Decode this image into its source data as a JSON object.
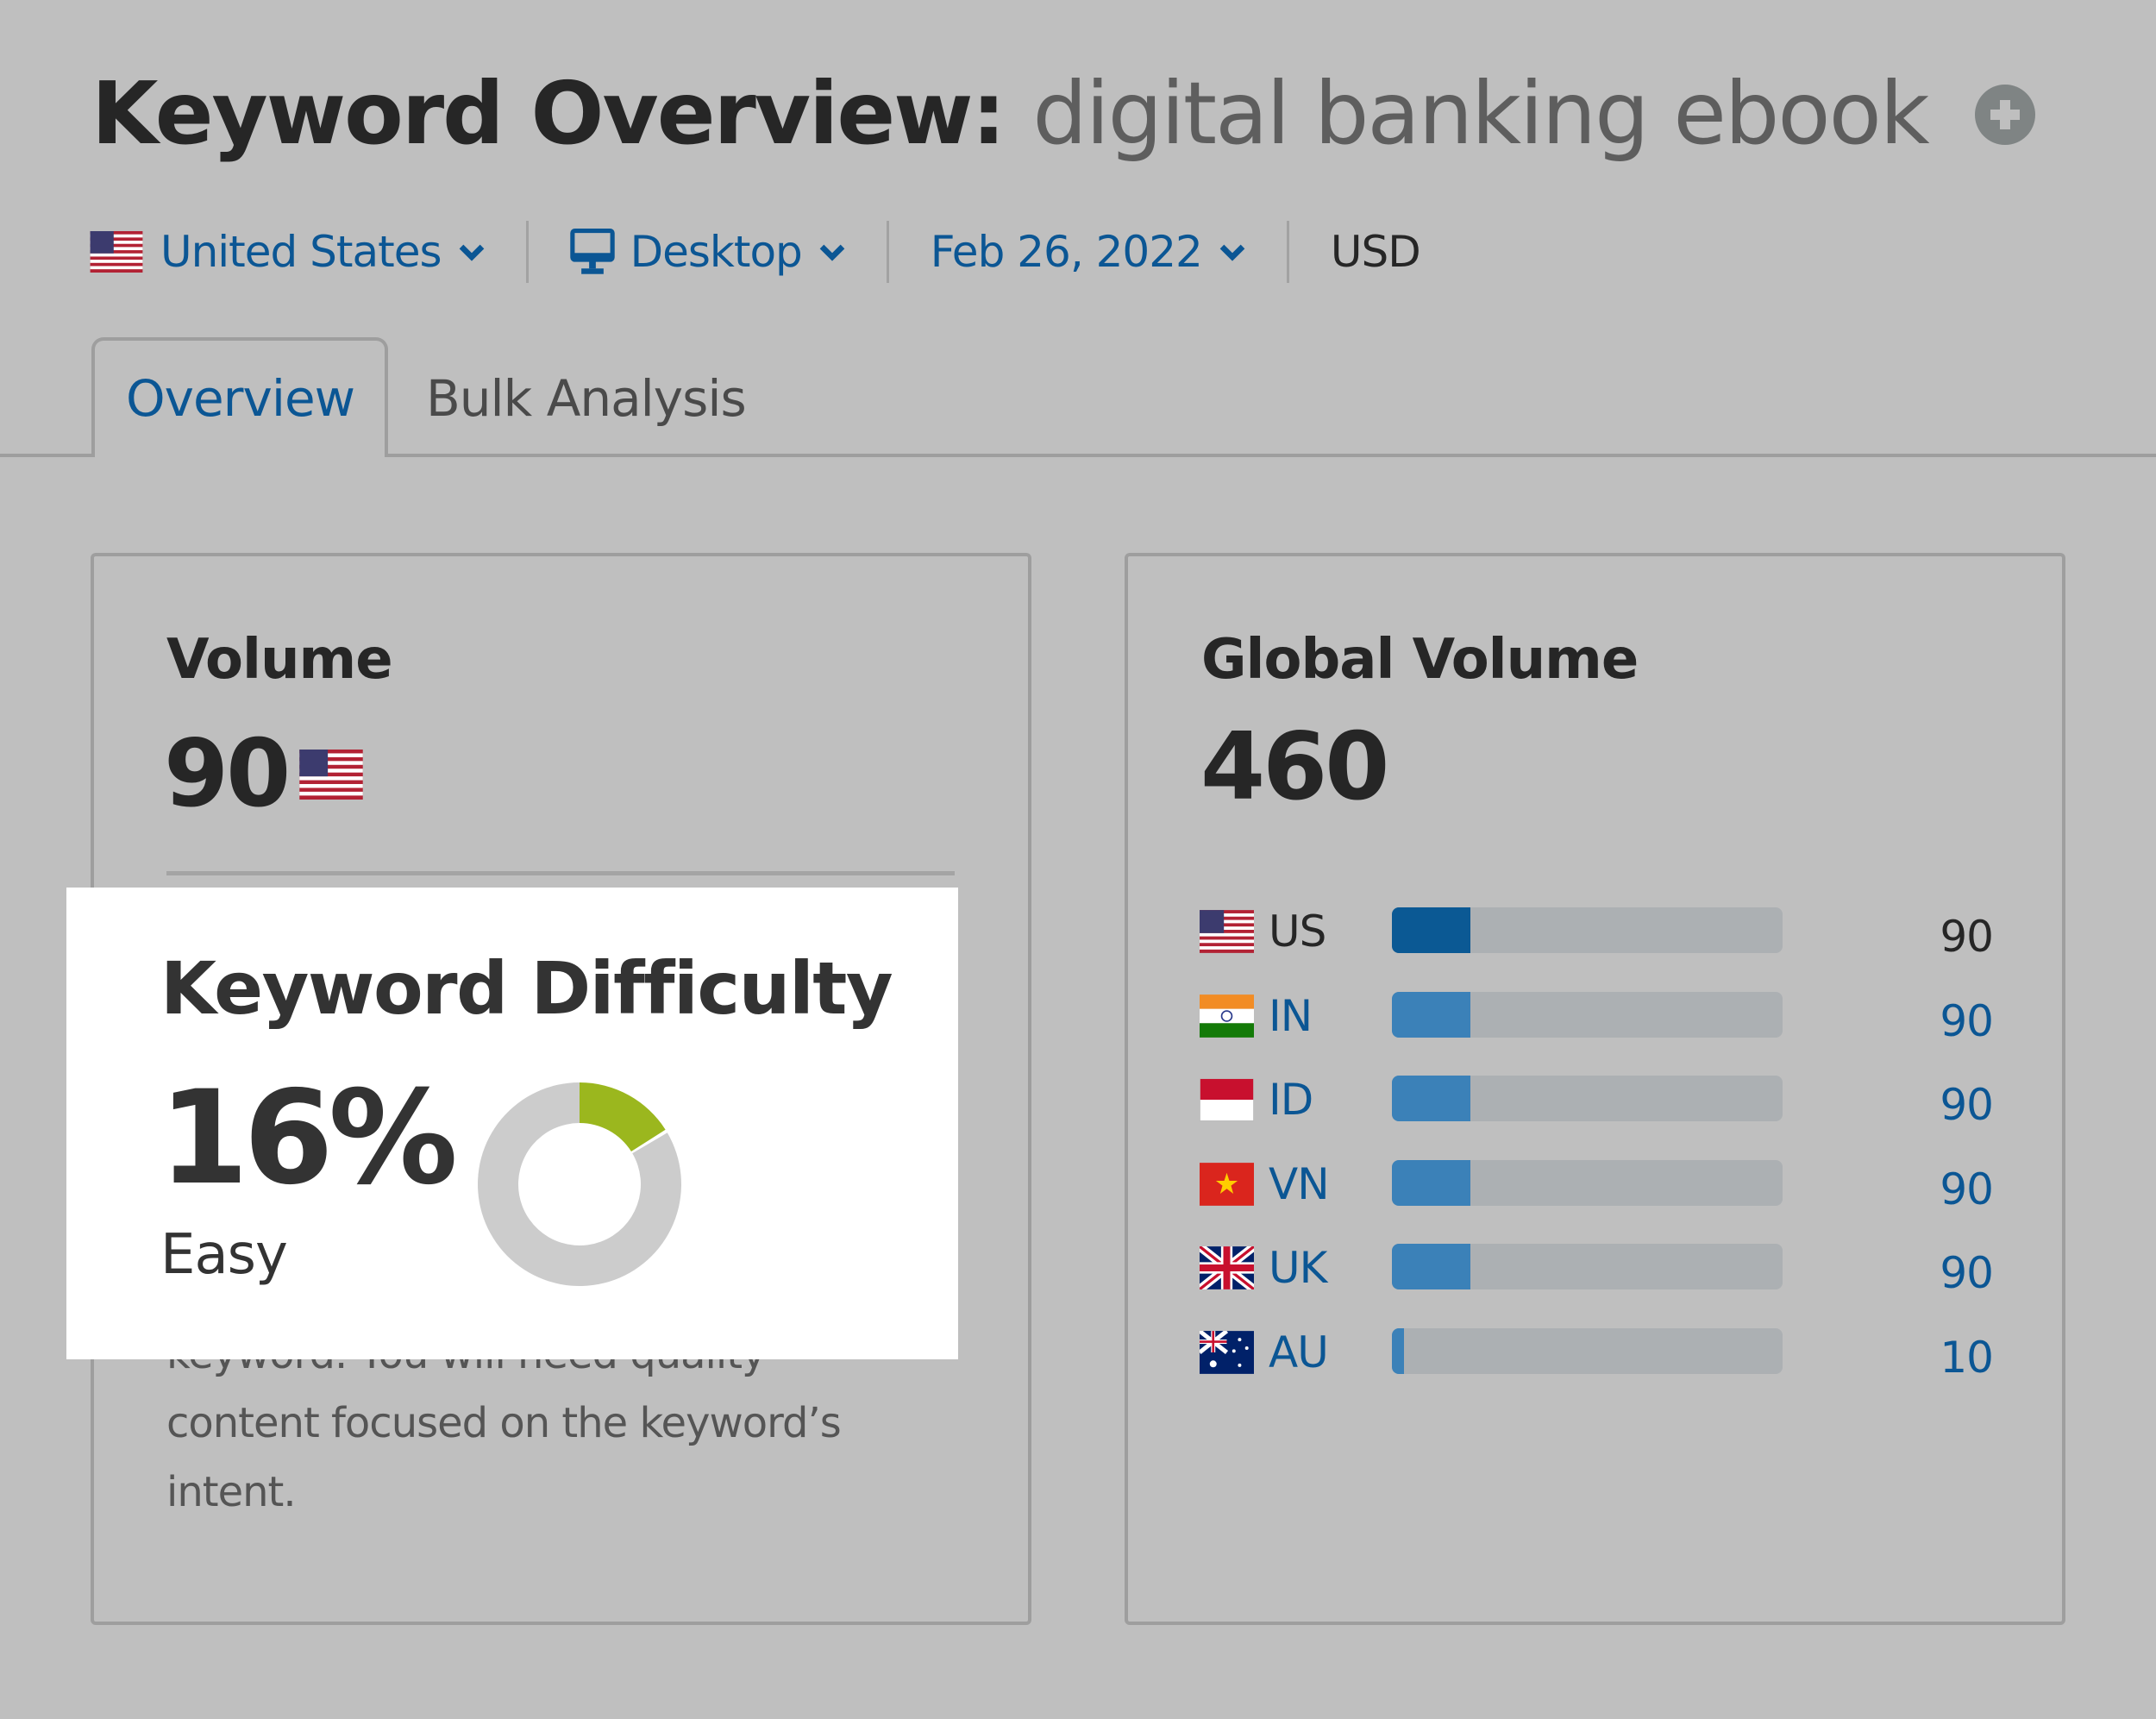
{
  "header": {
    "title_prefix": "Keyword Overview:",
    "keyword": "digital banking ebook",
    "add_icon": "plus-circle-icon"
  },
  "filters": {
    "country": {
      "label": "United States",
      "flag": "us-flag-icon"
    },
    "device": {
      "label": "Desktop",
      "icon": "desktop-icon"
    },
    "date": {
      "label": "Feb 26, 2022"
    },
    "currency": "USD"
  },
  "tabs": [
    {
      "label": "Overview",
      "active": true
    },
    {
      "label": "Bulk Analysis",
      "active": false
    }
  ],
  "volume_card": {
    "heading": "Volume",
    "value": "90",
    "flag": "us-flag-icon"
  },
  "keyword_difficulty": {
    "heading": "Keyword Difficulty",
    "value": "16%",
    "percent": 16,
    "level": "Easy",
    "description_lines": [
      "keyword. You will need quality",
      "content focused on the keyword’s",
      "intent."
    ],
    "colors": {
      "fill": "#9bb71e",
      "track": "#cccccc"
    }
  },
  "global_volume": {
    "heading": "Global Volume",
    "value": "460",
    "max": 450,
    "rows": [
      {
        "code": "US",
        "value": "90",
        "num": 90,
        "flag": "us"
      },
      {
        "code": "IN",
        "value": "90",
        "num": 90,
        "flag": "in"
      },
      {
        "code": "ID",
        "value": "90",
        "num": 90,
        "flag": "id"
      },
      {
        "code": "VN",
        "value": "90",
        "num": 90,
        "flag": "vn"
      },
      {
        "code": "UK",
        "value": "90",
        "num": 90,
        "flag": "uk"
      },
      {
        "code": "AU",
        "value": "10",
        "num": 10,
        "flag": "au"
      }
    ]
  },
  "colors": {
    "link": "#0b5694",
    "bar_primary": "#0b5994",
    "bar_secondary": "#3b81b8",
    "bar_track": "#acb0b3"
  }
}
